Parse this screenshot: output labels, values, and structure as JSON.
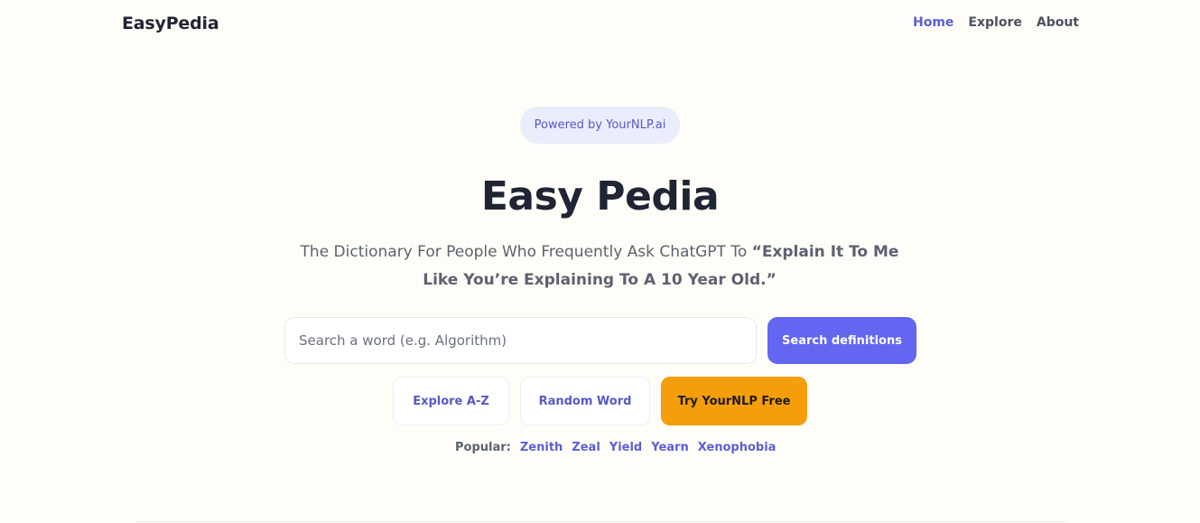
{
  "header": {
    "logo": "EasyPedia",
    "nav": {
      "home": "Home",
      "explore": "Explore",
      "about": "About"
    }
  },
  "hero": {
    "badge": "Powered by YourNLP.ai",
    "title": "Easy Pedia",
    "subtitle_plain": "The Dictionary For People Who Frequently Ask ChatGPT To ",
    "subtitle_bold": "“Explain It To Me Like You’re Explaining To A 10 Year Old.”"
  },
  "search": {
    "placeholder": "Search a word (e.g. Algorithm)",
    "value": "",
    "button_label": "Search definitions"
  },
  "actions": {
    "explore_az": "Explore A-Z",
    "random_word": "Random Word",
    "try_yournlp": "Try YourNLP Free"
  },
  "popular": {
    "label": "Popular:",
    "words": [
      "Zenith",
      "Zeal",
      "Yield",
      "Yearn",
      "Xenophobia"
    ]
  },
  "colors": {
    "accent": "#6366f1",
    "link": "#5b5fd6",
    "cta": "#f59e0b",
    "background": "#fffdf8"
  }
}
